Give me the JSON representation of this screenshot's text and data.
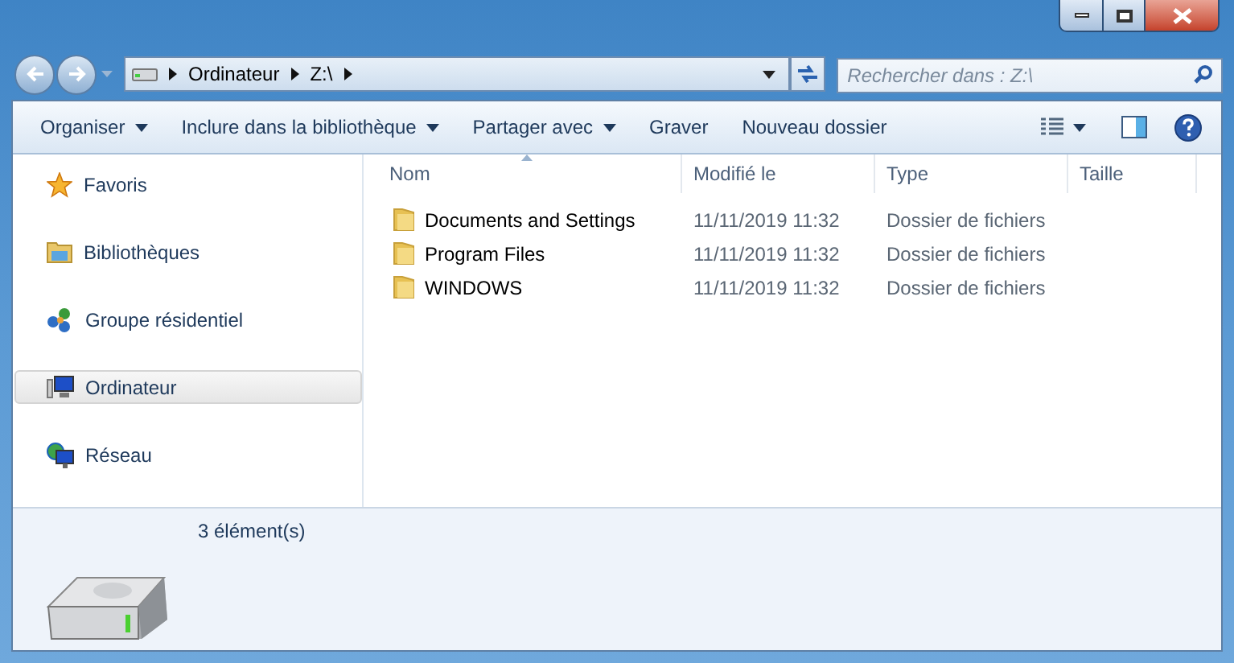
{
  "address": {
    "crumbs": [
      "Ordinateur",
      "Z:\\"
    ]
  },
  "search": {
    "placeholder": "Rechercher dans : Z:\\"
  },
  "toolbar": [
    {
      "label": "Organiser",
      "has_menu": true
    },
    {
      "label": "Inclure dans la bibliothèque",
      "has_menu": true
    },
    {
      "label": "Partager avec",
      "has_menu": true
    },
    {
      "label": "Graver",
      "has_menu": false
    },
    {
      "label": "Nouveau dossier",
      "has_menu": false
    }
  ],
  "navigation": [
    {
      "label": "Favoris",
      "kind": "star",
      "selected": false
    },
    {
      "label": "Bibliothèques",
      "kind": "library",
      "selected": false
    },
    {
      "label": "Groupe résidentiel",
      "kind": "homegroup",
      "selected": false
    },
    {
      "label": "Ordinateur",
      "kind": "computer",
      "selected": true
    },
    {
      "label": "Réseau",
      "kind": "network",
      "selected": false
    }
  ],
  "table": {
    "columns": [
      {
        "label": "Nom",
        "sorted": true
      },
      {
        "label": "Modifié le",
        "sorted": false
      },
      {
        "label": "Type",
        "sorted": false
      },
      {
        "label": "Taille",
        "sorted": false
      }
    ],
    "rows": [
      {
        "name": "Documents and Settings",
        "modified": "11/11/2019 11:32",
        "type": "Dossier de fichiers"
      },
      {
        "name": "Program Files",
        "modified": "11/11/2019 11:32",
        "type": "Dossier de fichiers"
      },
      {
        "name": "WINDOWS",
        "modified": "11/11/2019 11:32",
        "type": "Dossier de fichiers"
      }
    ]
  },
  "details": {
    "count": "3 élément(s)"
  }
}
